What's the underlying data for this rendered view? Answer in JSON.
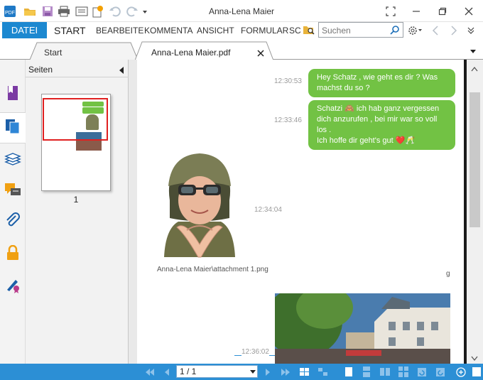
{
  "app": {
    "title": "Anna-Lena Maier"
  },
  "ribbon": {
    "file_tab": "DATEI",
    "tabs": [
      "START",
      "BEARBEITE",
      "KOMMENTA",
      "ANSICHT",
      "FORMULAR",
      "SC"
    ],
    "search_placeholder": "Suchen"
  },
  "tabs": {
    "start_label": "Start",
    "doc_label": "Anna-Lena Maier.pdf"
  },
  "pages_panel": {
    "title": "Seiten",
    "page_number": "1"
  },
  "chat": {
    "messages": [
      {
        "time": "12:30:53",
        "text_lines": [
          "Hey Schatz , wie geht es dir ? Was",
          "machst du so ?"
        ]
      },
      {
        "time": "12:33:46",
        "text_lines": [
          "Schatzi  🙈 ich hab ganz vergessen",
          "dich anzurufen , bei mir war so voll los .",
          "Ich hoffe dir geht's gut  ❤️🥂"
        ]
      }
    ],
    "attachment_time": "12:34:04",
    "attachment_caption": "Anna-Lena Maier\\attachment 1.png",
    "stray_char": "g",
    "photo_time": "12:36:02"
  },
  "status": {
    "page_display": "1 / 1"
  },
  "colors": {
    "accent": "#1c88d0",
    "statusbar": "#2c8fd5",
    "bubble": "#72c244",
    "selection": "#e02020"
  }
}
